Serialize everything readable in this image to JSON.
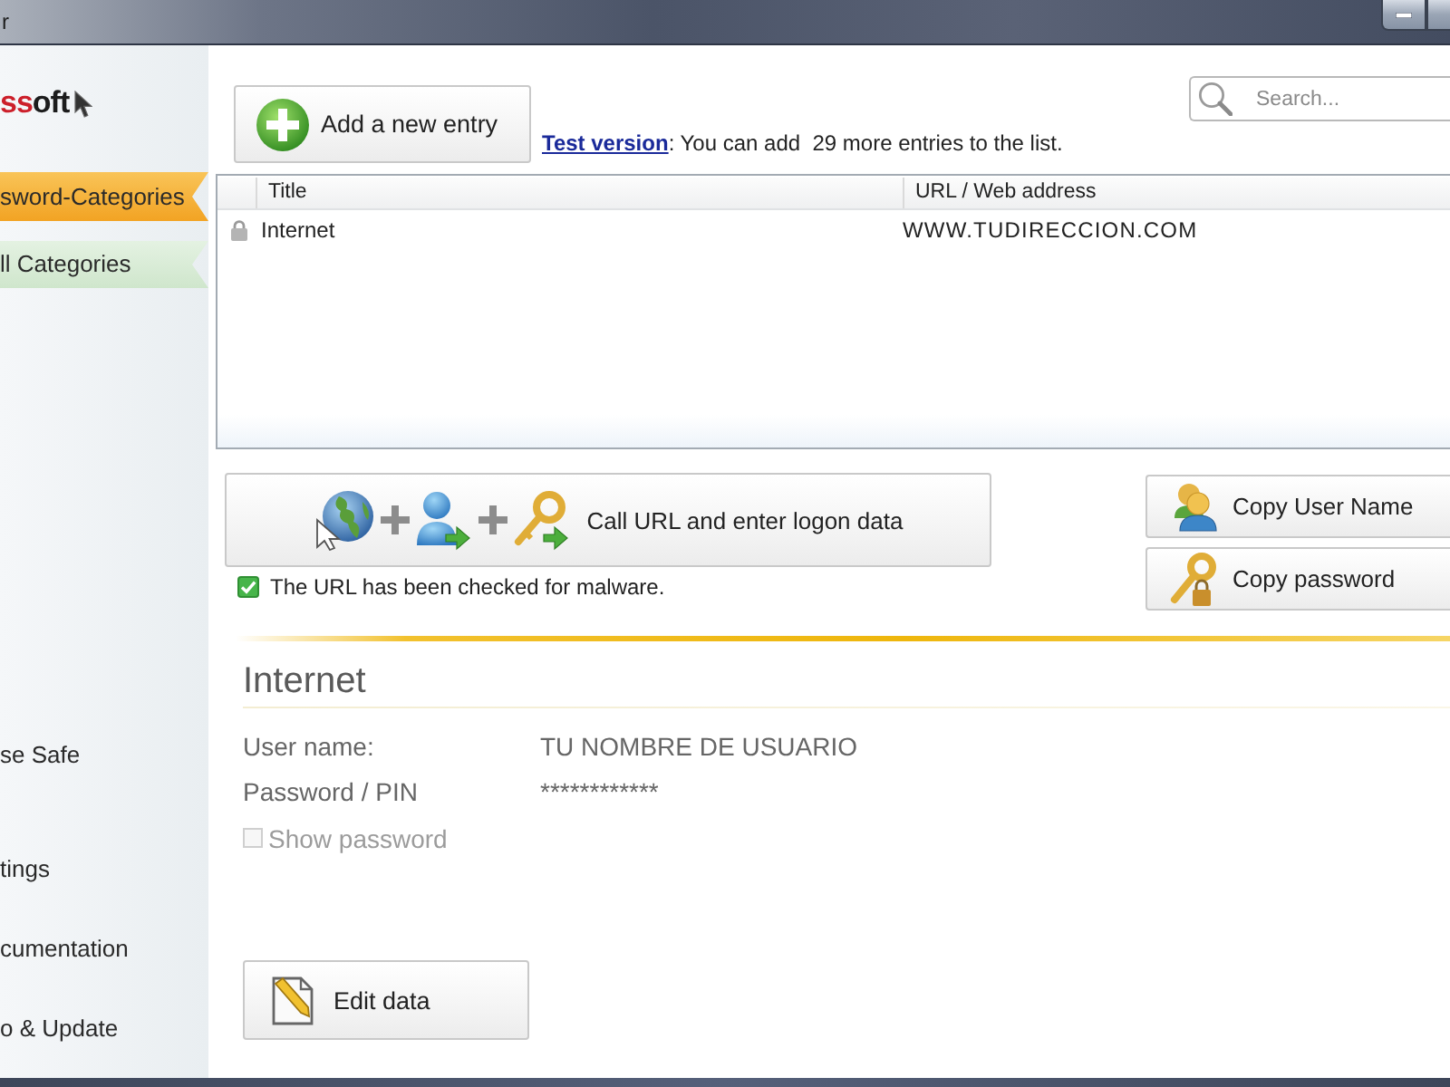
{
  "window": {
    "title": "r"
  },
  "sidebar": {
    "logo": [
      {
        "text": "ss",
        "color": "#cc1f2a"
      },
      {
        "text": "oft",
        "color": "#1c1c1c"
      }
    ],
    "category_header": "sword-Categories",
    "categories": [
      {
        "label": "ll Categories",
        "selected": true
      }
    ],
    "menu": [
      {
        "label": "se Safe"
      },
      {
        "label": "tings"
      },
      {
        "label": "cumentation"
      },
      {
        "label": "o & Update"
      }
    ]
  },
  "toolbar": {
    "add_button": "Add a new entry",
    "notice": {
      "link": "Test version",
      "text": ": You can add  29 more entries to the list."
    },
    "search": {
      "placeholder": "Search..."
    }
  },
  "table": {
    "columns": [
      "Title",
      "URL / Web address"
    ],
    "rows": [
      {
        "title": "Internet",
        "url": "WWW.TUDIRECCION.COM",
        "selected": false
      }
    ]
  },
  "actions": {
    "call_button": "Call URL and enter logon data",
    "malware_check": {
      "checked": true,
      "label": "The URL has been checked for malware."
    },
    "copy_buttons": [
      {
        "kind": "user",
        "label": "Copy User Name"
      },
      {
        "kind": "key",
        "label": "Copy password"
      }
    ]
  },
  "details": {
    "title": "Internet",
    "fields": [
      {
        "label": "User name:",
        "value": "TU NOMBRE DE USUARIO"
      },
      {
        "label": "Password / PIN",
        "value": "************"
      }
    ],
    "show_password": {
      "label": "Show password",
      "checked": false,
      "disabled": true
    },
    "edit_button": "Edit data"
  }
}
